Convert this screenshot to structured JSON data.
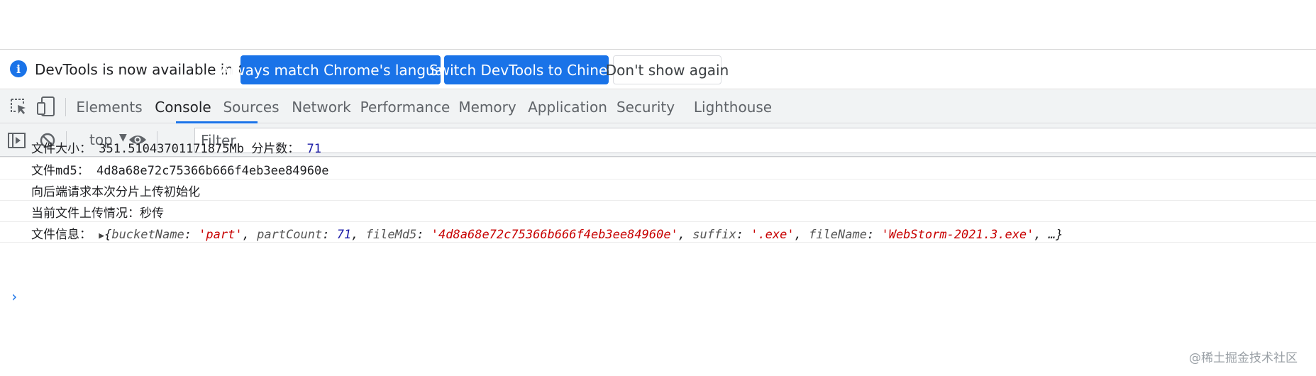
{
  "infobar": {
    "icon": "info-icon",
    "message": "DevTools is now available in Chinese!",
    "btn_match": "Always match Chrome's language",
    "btn_switch": "Switch DevTools to Chinese",
    "btn_dismiss": "Don't show again"
  },
  "tabs": [
    {
      "label": "Elements",
      "active": false
    },
    {
      "label": "Console",
      "active": true
    },
    {
      "label": "Sources",
      "active": false
    },
    {
      "label": "Network",
      "active": false
    },
    {
      "label": "Performance",
      "active": false
    },
    {
      "label": "Memory",
      "active": false
    },
    {
      "label": "Application",
      "active": false
    },
    {
      "label": "Security",
      "active": false
    },
    {
      "label": "Lighthouse",
      "active": false
    }
  ],
  "toolbar_icons": [
    "inspect-element-icon",
    "device-toggle-icon",
    "sidebar-toggle-icon",
    "clear-console-icon",
    "live-expression-eye-icon"
  ],
  "console_toolbar": {
    "context": "top",
    "filter_placeholder": "Filter"
  },
  "messages": {
    "m1": {
      "label": "文件大小：",
      "value": "351.51043701171875Mb",
      "label2": "分片数：",
      "count": "71"
    },
    "m2": {
      "label": "文件md5：",
      "value": "4d8a68e72c75366b666f4eb3ee84960e"
    },
    "m3": {
      "text": "向后端请求本次分片上传初始化"
    },
    "m4": {
      "text": "当前文件上传情况：秒传"
    },
    "m5": {
      "label": "文件信息：",
      "k1": "bucketName",
      "v1": "'part'",
      "k2": "partCount",
      "v2": "71",
      "k3": "fileMd5",
      "v3": "'4d8a68e72c75366b666f4eb3ee84960e'",
      "k4": "suffix",
      "v4": "'.exe'",
      "k5": "fileName",
      "v5": "'WebStorm-2021.3.exe'",
      "more": "…}"
    }
  },
  "prompt": "›",
  "watermark": "@稀土掘金技术社区",
  "colors": {
    "accent": "#1a73e8",
    "string": "#c80000",
    "number": "#1a1aa6"
  }
}
